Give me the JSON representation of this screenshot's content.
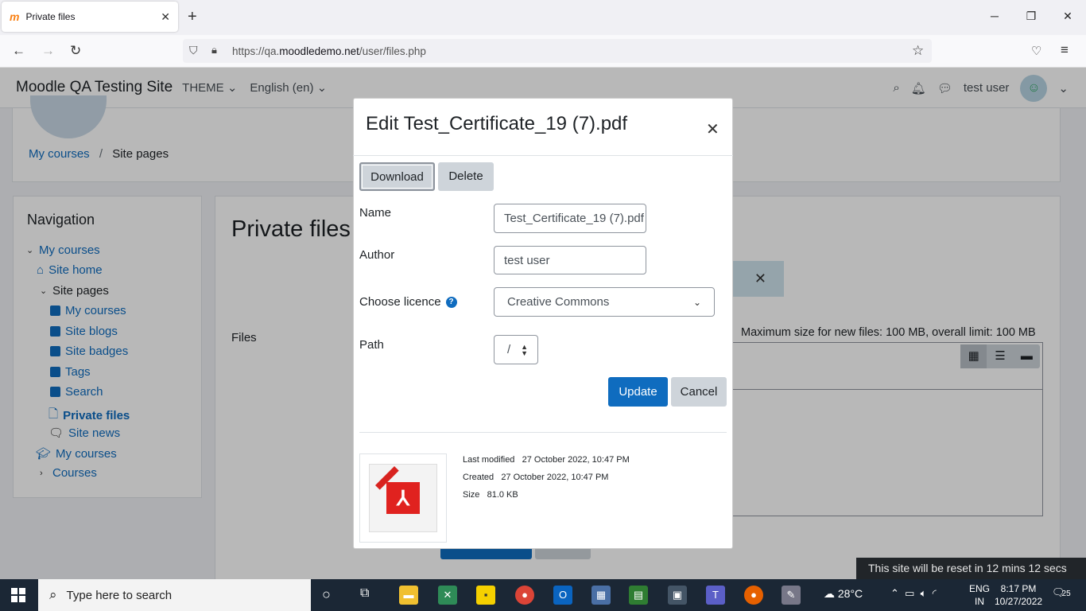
{
  "browser": {
    "tab_title": "Private files",
    "url_prefix": "https://qa.",
    "url_domain": "moodledemo.net",
    "url_path": "/user/files.php"
  },
  "moodle_nav": {
    "site_name": "Moodle QA Testing Site",
    "theme": "THEME",
    "language": "English (en)",
    "user": "test user"
  },
  "breadcrumb": {
    "item1": "My courses",
    "sep": "/",
    "item2": "Site pages"
  },
  "navigation": {
    "heading": "Navigation",
    "items": [
      {
        "label": "My courses"
      },
      {
        "label": "Site home"
      },
      {
        "label": "Site pages"
      },
      {
        "label": "My courses"
      },
      {
        "label": "Site blogs"
      },
      {
        "label": "Site badges"
      },
      {
        "label": "Tags"
      },
      {
        "label": "Search"
      },
      {
        "label": "Private files"
      },
      {
        "label": "Site news"
      },
      {
        "label": "My courses"
      },
      {
        "label": "Courses"
      }
    ]
  },
  "main": {
    "title": "Private files",
    "files_label": "Files",
    "max_size": "Maximum size for new files: 100 MB, overall limit: 100 MB"
  },
  "modal": {
    "title": "Edit Test_Certificate_19 (7).pdf",
    "download": "Download",
    "delete": "Delete",
    "name_label": "Name",
    "name_value": "Test_Certificate_19 (7).pdf",
    "author_label": "Author",
    "author_value": "test user",
    "licence_label": "Choose licence",
    "licence_value": "Creative Commons",
    "path_label": "Path",
    "path_value": "/",
    "update": "Update",
    "cancel": "Cancel",
    "last_modified_label": "Last modified",
    "last_modified_value": "27 October 2022, 10:47 PM",
    "created_label": "Created",
    "created_value": "27 October 2022, 10:47 PM",
    "size_label": "Size",
    "size_value": "81.0 KB"
  },
  "toast": "This site will be reset in 12 mins 12 secs",
  "taskbar": {
    "search_placeholder": "Type here to search",
    "temperature": "28°C",
    "lang_line1": "ENG",
    "lang_line2": "IN",
    "time": "8:17 PM",
    "date": "10/27/2022",
    "notifications": "25"
  }
}
